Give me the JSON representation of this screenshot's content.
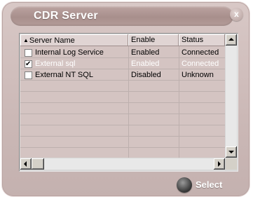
{
  "window": {
    "title": "CDR Server",
    "close_glyph": "x"
  },
  "table": {
    "columns": [
      {
        "label": "Server Name",
        "sort_indicator": "▲"
      },
      {
        "label": "Enable"
      },
      {
        "label": "Status"
      }
    ],
    "rows": [
      {
        "checked": false,
        "name": "Internal Log Service",
        "enable": "Enabled",
        "status": "Connected"
      },
      {
        "checked": true,
        "name": "External sql",
        "enable": "Enabled",
        "status": "Connected"
      },
      {
        "checked": false,
        "name": "External NT SQL",
        "enable": "Disabled",
        "status": "Unknown"
      }
    ]
  },
  "footer": {
    "select_label": "Select"
  },
  "colors": {
    "window_bg": "#cbb8b6",
    "title_bar": "#a88f8c",
    "list_bg": "#d4c4c2",
    "header_bg": "#e0d4d3"
  }
}
